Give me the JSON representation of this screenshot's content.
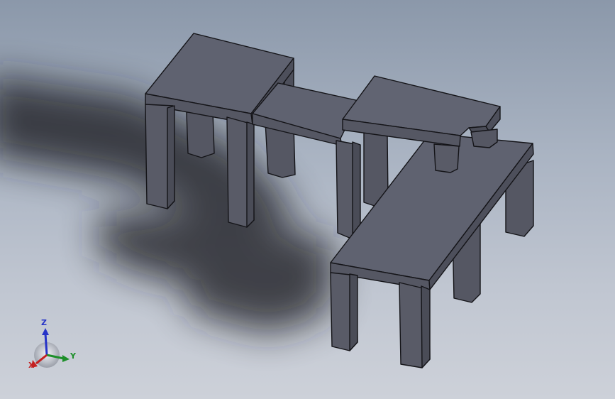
{
  "viewport": {
    "background_top": "#8b98aa",
    "background_bottom": "#cdd1d9",
    "model_face_color": "#5b5d6a",
    "model_top_color": "#5f6270",
    "model_side_color": "#4d4f5b",
    "edge_color": "#141418"
  },
  "triad": {
    "x_label": "X",
    "y_label": "Y",
    "z_label": "Z",
    "x_color": "#c42121",
    "y_color": "#1d8f2a",
    "z_color": "#2633c8"
  }
}
